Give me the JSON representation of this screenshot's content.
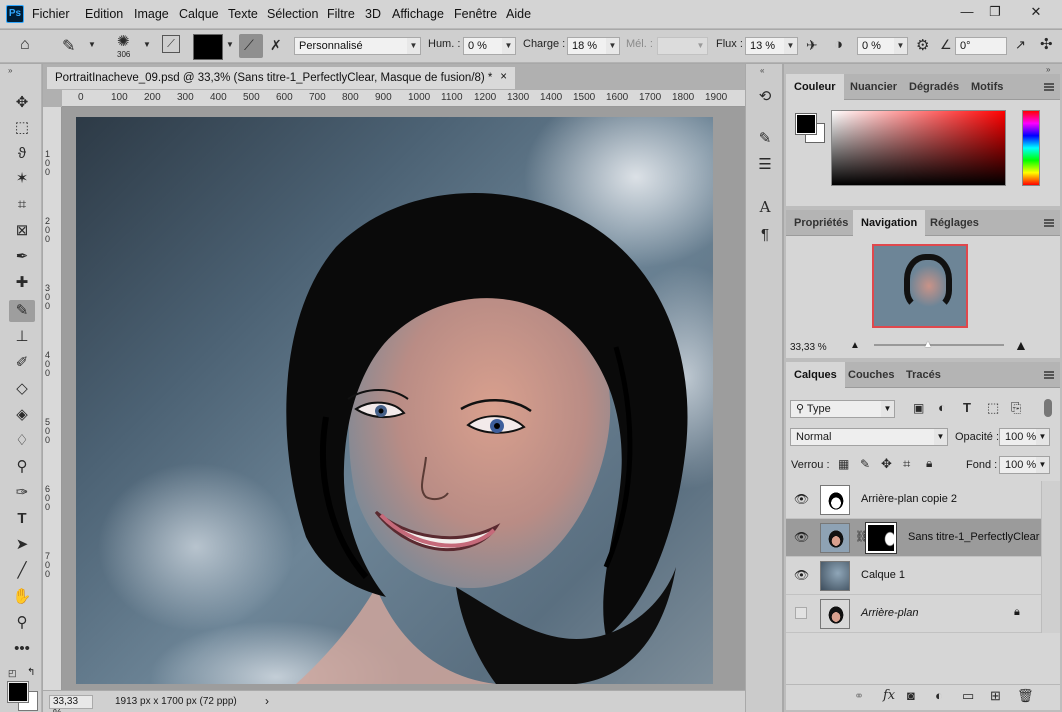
{
  "app": {
    "logo": "Ps",
    "menu": [
      "Fichier",
      "Edition",
      "Image",
      "Calque",
      "Texte",
      "Sélection",
      "Filtre",
      "3D",
      "Affichage",
      "Fenêtre",
      "Aide"
    ],
    "window_controls": {
      "minimize": "—",
      "restore": "❐",
      "close": "✕"
    }
  },
  "options": {
    "brush_size": "306",
    "preset": "Personnalisé",
    "hum_label": "Hum. :",
    "hum_value": "0 %",
    "charge_label": "Charge :",
    "charge_value": "18 %",
    "mel_label": "Mél. :",
    "flux_label": "Flux :",
    "flux_value": "13 %",
    "angle_value": "0 %",
    "extra_value": "0°"
  },
  "document": {
    "tab_title": "PortraitInacheve_09.psd @ 33,3% (Sans titre-1_PerfectlyClear, Masque de fusion/8) *",
    "close": "×",
    "ruler_top": [
      "0",
      "100",
      "200",
      "300",
      "400",
      "500",
      "600",
      "700",
      "800",
      "900",
      "1000",
      "1100",
      "1200",
      "1300",
      "1400",
      "1500",
      "1600",
      "1700",
      "1800",
      "1900"
    ],
    "ruler_left": [
      "1",
      "0",
      "0",
      "2",
      "0",
      "0",
      "3",
      "0",
      "0",
      "4",
      "0",
      "0",
      "5",
      "0",
      "0",
      "6",
      "0",
      "0",
      "7",
      "0",
      "0"
    ],
    "zoom": "33,33 %",
    "dimensions": "1913 px x 1700 px (72 ppp)",
    "status_arrow": "›"
  },
  "color_panel": {
    "tabs": [
      "Couleur",
      "Nuancier",
      "Dégradés",
      "Motifs"
    ],
    "foreground": "#000000",
    "background": "#ffffff"
  },
  "nav_panel": {
    "tabs": [
      "Propriétés",
      "Navigation",
      "Réglages"
    ],
    "zoom": "33,33 %",
    "view_box_color": "#e0484d"
  },
  "layers_panel": {
    "tabs": [
      "Calques",
      "Couches",
      "Tracés"
    ],
    "filter_kind": "Type",
    "blend_mode": "Normal",
    "opacity_label": "Opacité :",
    "opacity_value": "100 %",
    "lock_label": "Verrou :",
    "fill_label": "Fond :",
    "fill_value": "100 %",
    "layers": [
      {
        "name": "Arrière-plan copie 2",
        "visible": true,
        "selected": false
      },
      {
        "name": "Sans titre-1_PerfectlyClear",
        "visible": true,
        "selected": true
      },
      {
        "name": "Calque 1",
        "visible": true,
        "selected": false
      },
      {
        "name": "Arrière-plan",
        "visible": false,
        "selected": false,
        "locked": true
      }
    ],
    "footer_icons": [
      "link-icon",
      "fx-icon",
      "mask-icon",
      "adjustment-icon",
      "group-icon",
      "new-layer-icon",
      "trash-icon"
    ]
  }
}
